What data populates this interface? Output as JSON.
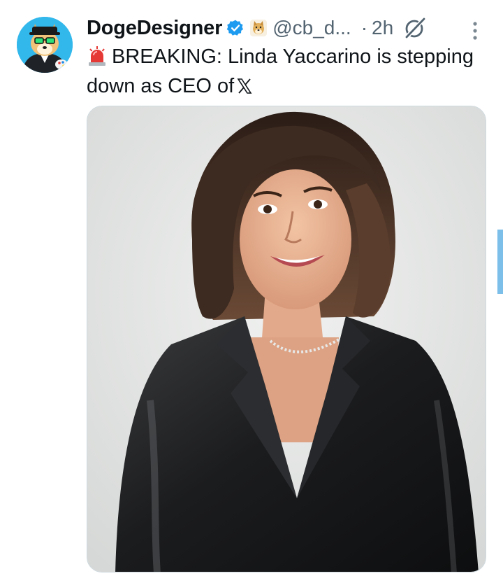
{
  "tweet": {
    "display_name": "DogeDesigner",
    "handle": "@cb_d...",
    "separator": "·",
    "time_ago": "2h",
    "text_main": "BREAKING: Linda Yaccarino is stepping down as CEO of",
    "icons": {
      "verified": "verified-badge-icon",
      "affiliate": "doge-affiliate-icon",
      "grok": "grok-icon",
      "more": "more-vertical-icon",
      "siren": "police-siren-icon",
      "x_logo": "x-logo-icon"
    },
    "colors": {
      "text": "#0f1419",
      "secondary": "#536471",
      "verified_blue": "#1d9bf0",
      "avatar_bg": "#33b8ec"
    }
  }
}
